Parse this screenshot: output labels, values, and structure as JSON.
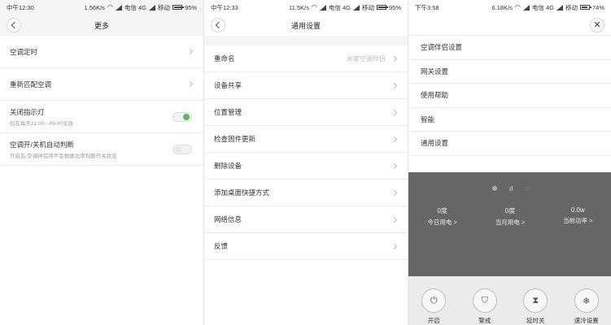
{
  "panel1": {
    "status": {
      "time": "中午12:30",
      "speed": "1.56K/s",
      "carrier": "电信 4G",
      "carrier2": "移动",
      "battery": "95%"
    },
    "title": "更多",
    "rows": [
      {
        "label": "空调定时"
      },
      {
        "label": "重新匹配空调"
      },
      {
        "label": "关闭指示灯",
        "sub": "仅在每天21:00---09:00生效",
        "toggle": "on"
      },
      {
        "label": "空调开/关机自动判断",
        "sub": "开启后,空调伴侣将不会根据功率判断开关状态",
        "toggle": "off"
      }
    ]
  },
  "panel2": {
    "status": {
      "time": "中午12:33",
      "speed": "11.5K/s",
      "carrier": "电信 4G",
      "carrier2": "移动",
      "battery": "95%"
    },
    "title": "通用设置",
    "rows": [
      {
        "label": "重命名",
        "value": "米家空调伴侣"
      },
      {
        "label": "设备共享"
      },
      {
        "label": "位置管理"
      },
      {
        "label": "检查固件更新"
      },
      {
        "label": "删除设备"
      },
      {
        "label": "添加桌面快捷方式"
      },
      {
        "label": "网络信息"
      },
      {
        "label": "反馈"
      }
    ]
  },
  "panel3": {
    "status": {
      "time": "下午3:58",
      "speed": "6.18K/s",
      "carrier": "电信 4G",
      "carrier2": "移动",
      "battery": "74%"
    },
    "menu": [
      {
        "label": "空调伴侣设置"
      },
      {
        "label": "网关设置"
      },
      {
        "label": "使用帮助"
      },
      {
        "label": "智能"
      },
      {
        "label": "通用设置"
      }
    ],
    "stats": [
      {
        "value": "0度",
        "label": "今日用电 >"
      },
      {
        "value": "0度",
        "label": "当月用电 >"
      },
      {
        "value": "0.0w",
        "label": "当前功率 >"
      }
    ],
    "controls": [
      {
        "label": "开启",
        "icon": "power-icon"
      },
      {
        "label": "警戒",
        "icon": "shield-icon"
      },
      {
        "label": "延时关",
        "icon": "hourglass-icon"
      },
      {
        "label": "速冷设置",
        "icon": "snowflake-icon"
      }
    ]
  }
}
